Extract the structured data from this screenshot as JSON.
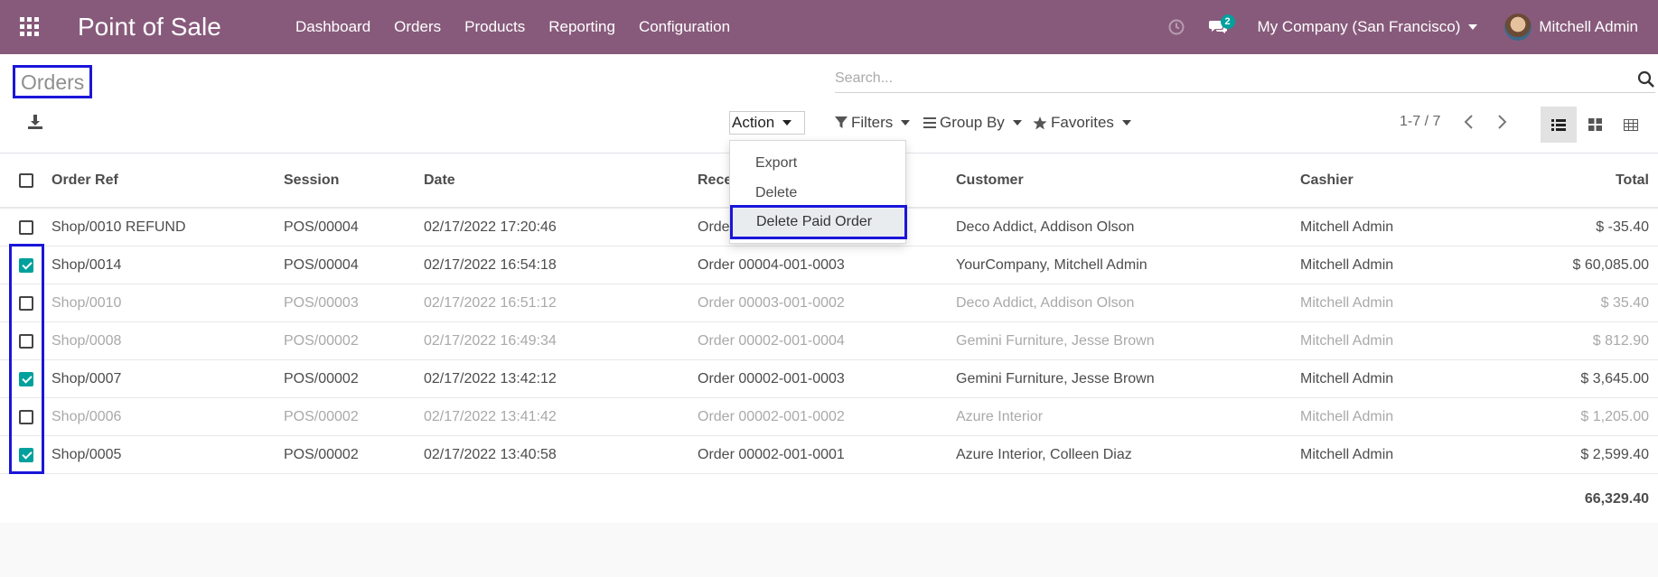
{
  "navbar": {
    "app_title": "Point of Sale",
    "menu": [
      "Dashboard",
      "Orders",
      "Products",
      "Reporting",
      "Configuration"
    ],
    "chat_count": "2",
    "company": "My Company (San Francisco)",
    "user": "Mitchell Admin",
    "color": "#875a7b"
  },
  "control": {
    "title": "Orders",
    "search_placeholder": "Search...",
    "action_label": "Action",
    "filters_label": "Filters",
    "groupby_label": "Group By",
    "favorites_label": "Favorites",
    "pager": "1-7 / 7"
  },
  "dropdown": {
    "items": [
      "Export",
      "Delete",
      "Delete Paid Order"
    ]
  },
  "table": {
    "headers": {
      "order_ref": "Order Ref",
      "session": "Session",
      "date": "Date",
      "receipt": "Rece",
      "customer": "Customer",
      "cashier": "Cashier",
      "total": "Total"
    },
    "rows": [
      {
        "checked": false,
        "dim": false,
        "order_ref": "Shop/0010 REFUND",
        "session": "POS/00004",
        "date": "02/17/2022 17:20:46",
        "receipt": "Orde",
        "customer": "Deco Addict, Addison Olson",
        "cashier": "Mitchell Admin",
        "total": "$ -35.40"
      },
      {
        "checked": true,
        "dim": false,
        "order_ref": "Shop/0014",
        "session": "POS/00004",
        "date": "02/17/2022 16:54:18",
        "receipt": "Order 00004-001-0003",
        "customer": "YourCompany, Mitchell Admin",
        "cashier": "Mitchell Admin",
        "total": "$ 60,085.00"
      },
      {
        "checked": false,
        "dim": true,
        "order_ref": "Shop/0010",
        "session": "POS/00003",
        "date": "02/17/2022 16:51:12",
        "receipt": "Order 00003-001-0002",
        "customer": "Deco Addict, Addison Olson",
        "cashier": "Mitchell Admin",
        "total": "$ 35.40"
      },
      {
        "checked": false,
        "dim": true,
        "order_ref": "Shop/0008",
        "session": "POS/00002",
        "date": "02/17/2022 16:49:34",
        "receipt": "Order 00002-001-0004",
        "customer": "Gemini Furniture, Jesse Brown",
        "cashier": "Mitchell Admin",
        "total": "$ 812.90"
      },
      {
        "checked": true,
        "dim": false,
        "order_ref": "Shop/0007",
        "session": "POS/00002",
        "date": "02/17/2022 13:42:12",
        "receipt": "Order 00002-001-0003",
        "customer": "Gemini Furniture, Jesse Brown",
        "cashier": "Mitchell Admin",
        "total": "$ 3,645.00"
      },
      {
        "checked": false,
        "dim": true,
        "order_ref": "Shop/0006",
        "session": "POS/00002",
        "date": "02/17/2022 13:41:42",
        "receipt": "Order 00002-001-0002",
        "customer": "Azure Interior",
        "cashier": "Mitchell Admin",
        "total": "$ 1,205.00"
      },
      {
        "checked": true,
        "dim": false,
        "order_ref": "Shop/0005",
        "session": "POS/00002",
        "date": "02/17/2022 13:40:58",
        "receipt": "Order 00002-001-0001",
        "customer": "Azure Interior, Colleen Diaz",
        "cashier": "Mitchell Admin",
        "total": "$ 2,599.40"
      }
    ],
    "grand_total": "66,329.40"
  }
}
